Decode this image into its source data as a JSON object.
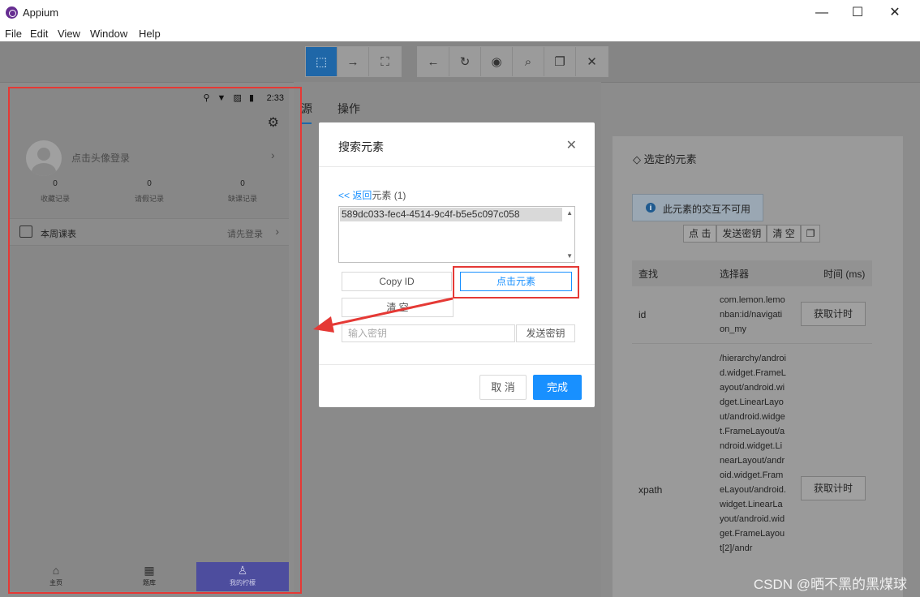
{
  "window": {
    "title": "Appium",
    "controls": {
      "minimize": "—",
      "maximize": "☐",
      "close": "✕"
    }
  },
  "menu": [
    "File",
    "Edit",
    "View",
    "Window",
    "Help"
  ],
  "toolbar": {
    "group1": [
      {
        "icon": "select-elements-icon",
        "glyph": "⬚",
        "active": true
      },
      {
        "icon": "swipe-icon",
        "glyph": "→"
      },
      {
        "icon": "tap-coordinates-icon",
        "glyph": "⛶"
      }
    ],
    "group2": [
      {
        "icon": "back-icon",
        "glyph": "←"
      },
      {
        "icon": "refresh-icon",
        "glyph": "↻"
      },
      {
        "icon": "eye-icon",
        "glyph": "◉"
      },
      {
        "icon": "search-icon",
        "glyph": "⌕"
      },
      {
        "icon": "copy-icon",
        "glyph": "❐"
      },
      {
        "icon": "close-icon",
        "glyph": "✕"
      }
    ]
  },
  "device": {
    "time": "2:33",
    "status_icons": "⚲ ▼ ▨ ▮",
    "login_prompt": "点击头像登录",
    "stats": [
      {
        "num": "0",
        "label": "收藏记录"
      },
      {
        "num": "0",
        "label": "请假记录"
      },
      {
        "num": "0",
        "label": "缺课记录"
      }
    ],
    "schedule": {
      "title": "本周课表",
      "hint": "请先登录"
    },
    "nav": [
      {
        "icon": "home-icon",
        "glyph": "⌂",
        "label": "主页"
      },
      {
        "icon": "grid-icon",
        "glyph": "▦",
        "label": "题库"
      },
      {
        "icon": "person-icon",
        "glyph": "♙",
        "label": "我的柠檬"
      }
    ]
  },
  "tabs": {
    "source_partial": "源",
    "actions": "操作"
  },
  "right_panel": {
    "title": "选定的元素",
    "notice": "此元素的交互不可用",
    "actions": [
      "点 击",
      "发送密钥",
      "清 空"
    ],
    "table": {
      "headers": [
        "查找",
        "选择器",
        "时间 (ms)"
      ],
      "rows": [
        {
          "strategy": "id",
          "selector": "com.lemon.lemonban:id/navigation_my",
          "button": "获取计时"
        },
        {
          "strategy": "xpath",
          "selector": "/hierarchy/android.widget.FrameLayout/android.widget.LinearLayout/android.widget.FrameLayout/android.widget.LinearLayout/android.widget.FrameLayout/android.widget.LinearLayout/android.widget.FrameLayout[2]/andr",
          "button": "获取计时"
        }
      ]
    }
  },
  "modal": {
    "title": "搜索元素",
    "close": "✕",
    "back_link": "<< 返回",
    "back_suffix": "元素",
    "back_count": " (1)",
    "element_id": "589dc033-fec4-4514-9c4f-b5e5c097c058",
    "buttons": {
      "copy_id": "Copy ID",
      "tap_element": "点击元素",
      "clear": "清 空",
      "send_keys": "发送密钥"
    },
    "key_placeholder": "输入密钥",
    "cancel": "取 消",
    "done": "完成"
  },
  "watermark": "CSDN @晒不黑的黑煤球",
  "colors": {
    "accent": "#1890ff",
    "annotation": "#e53935",
    "active_tool": "#1f67a8"
  }
}
